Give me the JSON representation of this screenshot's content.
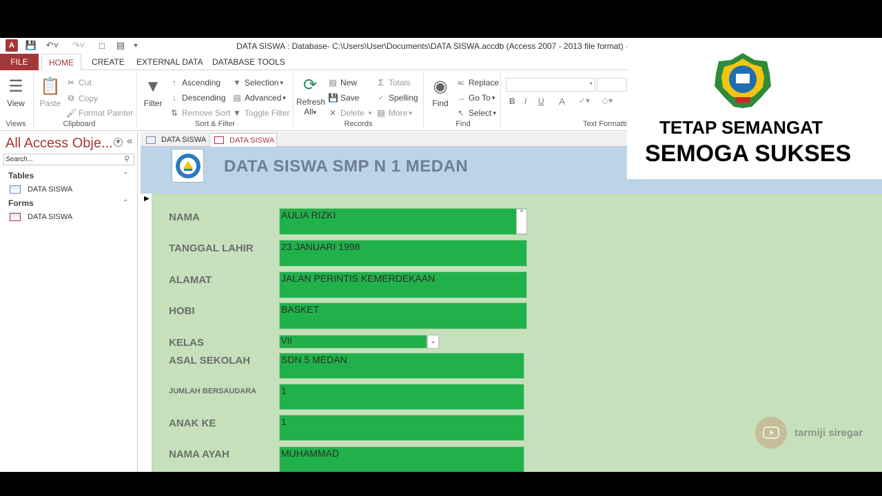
{
  "window": {
    "title": "DATA SISWA : Database- C:\\Users\\User\\Documents\\DATA SISWA.accdb (Access 2007 - 2013 file format) - Microsoft"
  },
  "ribbon_tabs": [
    "FILE",
    "HOME",
    "CREATE",
    "EXTERNAL DATA",
    "DATABASE TOOLS"
  ],
  "ribbon": {
    "views": {
      "view": "View",
      "group": "Views"
    },
    "clipboard": {
      "paste": "Paste",
      "cut": "Cut",
      "copy": "Copy",
      "format_painter": "Format Painter",
      "group": "Clipboard"
    },
    "sort_filter": {
      "filter": "Filter",
      "ascending": "Ascending",
      "descending": "Descending",
      "remove_sort": "Remove Sort",
      "selection": "Selection",
      "advanced": "Advanced",
      "toggle_filter": "Toggle Filter",
      "group": "Sort & Filter"
    },
    "records": {
      "refresh": "Refresh",
      "refresh_all": "All",
      "new": "New",
      "save": "Save",
      "delete": "Delete",
      "totals": "Totals",
      "spelling": "Spelling",
      "more": "More",
      "group": "Records"
    },
    "find": {
      "find": "Find",
      "replace": "Replace",
      "go_to": "Go To",
      "select": "Select",
      "group": "Find"
    },
    "text_formatting": {
      "bold": "B",
      "italic": "I",
      "underline": "U",
      "font_color": "A",
      "group": "Text Formatti"
    }
  },
  "nav": {
    "title": "All Access Obje...",
    "search_placeholder": "Search...",
    "sections": [
      {
        "label": "Tables",
        "items": [
          "DATA SISWA"
        ]
      },
      {
        "label": "Forms",
        "items": [
          "DATA SISWA"
        ]
      }
    ]
  },
  "doc_tabs": [
    "DATA SISWA",
    "DATA SISWA"
  ],
  "form": {
    "title": "DATA SISWA SMP N 1 MEDAN",
    "fields": [
      {
        "label": "NAMA",
        "value": "AULIA RIZKI"
      },
      {
        "label": "TANGGAL LAHIR",
        "value": "23 JANUARI 1998"
      },
      {
        "label": "ALAMAT",
        "value": "JALAN PERINTIS KEMERDEKAAN"
      },
      {
        "label": "HOBI",
        "value": "BASKET"
      },
      {
        "label": "KELAS",
        "value": "VII"
      },
      {
        "label": "ASAL SEKOLAH",
        "value": "SDN 5 MEDAN"
      },
      {
        "label": "JUMLAH BERSAUDARA",
        "value": "1"
      },
      {
        "label": "ANAK KE",
        "value": "1"
      },
      {
        "label": "NAMA AYAH",
        "value": "MUHAMMAD"
      }
    ]
  },
  "banner": {
    "line1": "TETAP SEMANGAT",
    "line2": "SEMOGA SUKSES"
  },
  "watermark": {
    "channel": "tarmiji siregar"
  },
  "colors": {
    "access_red": "#a4373a",
    "form_header": "#bcd4e8",
    "form_detail": "#c6e0bc",
    "field_green": "#21b14b"
  }
}
